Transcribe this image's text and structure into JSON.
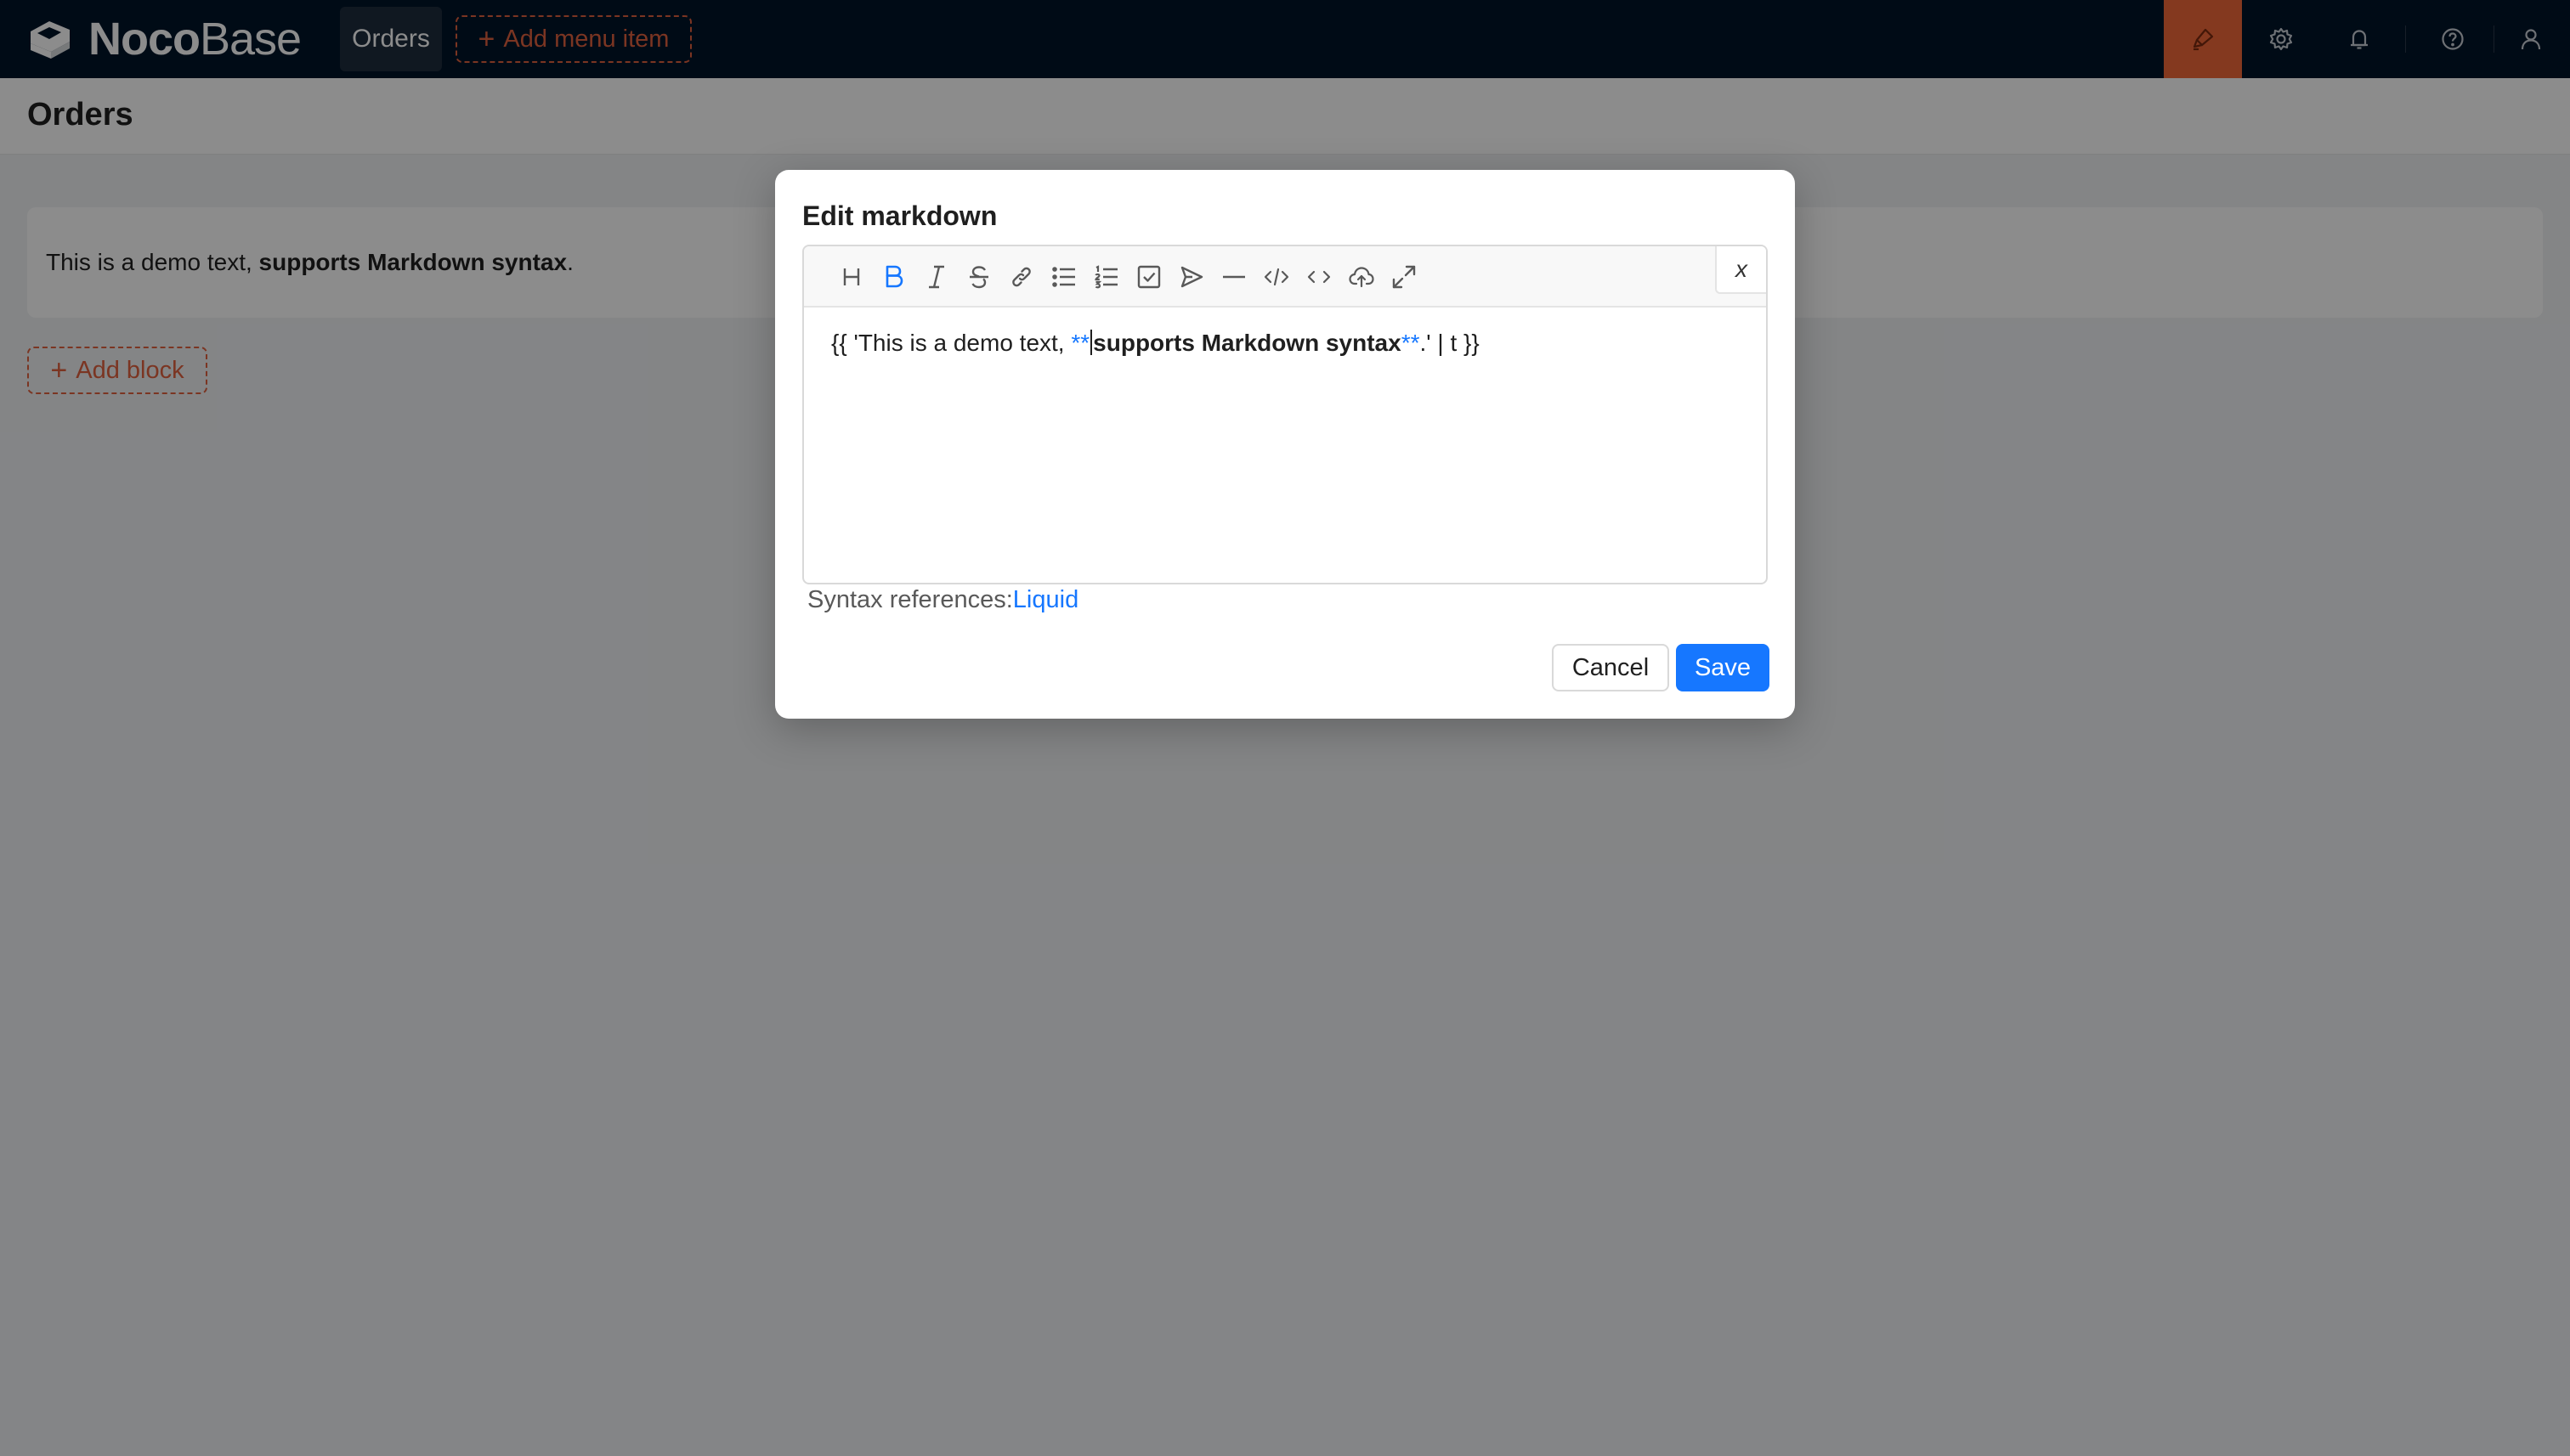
{
  "brand": {
    "name_bold": "Noco",
    "name_light": "Base"
  },
  "topbar": {
    "menu_items": [
      {
        "label": "Orders"
      }
    ],
    "add_menu_item_label": "Add menu item",
    "icons": [
      "highlight-icon",
      "settings-icon",
      "bell-icon",
      "question-circle-icon",
      "user-icon"
    ]
  },
  "page": {
    "title": "Orders",
    "markdown_block": {
      "text_plain": "This is a demo text, ",
      "text_bold": "supports Markdown syntax",
      "text_end": "."
    },
    "add_block_label": "Add block"
  },
  "modal": {
    "title": "Edit markdown",
    "toolbar": {
      "tools": [
        "heading",
        "bold",
        "italic",
        "strikethrough",
        "link",
        "unordered-list",
        "ordered-list",
        "checklist",
        "quote",
        "horizontal-rule",
        "code-block",
        "inline-code",
        "upload",
        "fullscreen"
      ],
      "close_label": "x"
    },
    "editor": {
      "part1": "{{ 'This is a demo text, ",
      "mark_open": "**",
      "bold_text": "supports Markdown syntax",
      "mark_close": "**",
      "part2": ".' | t }}"
    },
    "syntax_label": "Syntax references:",
    "syntax_link": "Liquid",
    "cancel_label": "Cancel",
    "save_label": "Save"
  },
  "colors": {
    "topbar_bg": "#001529",
    "accent_orange": "#e0613e",
    "primary_blue": "#1677ff",
    "design_active": "#f0683a"
  }
}
